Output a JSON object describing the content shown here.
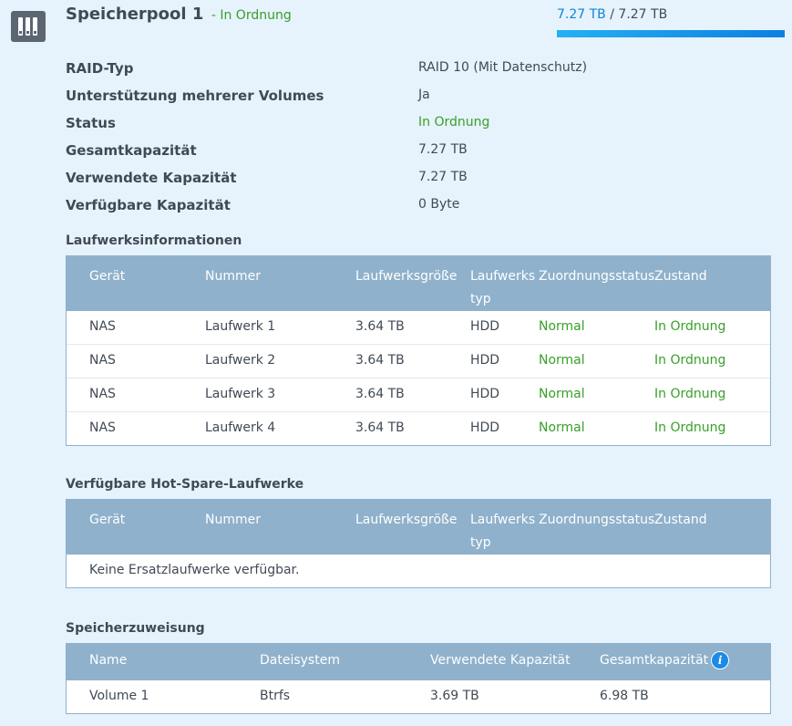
{
  "header": {
    "pool_name": "Speicherpool 1",
    "separator": "-",
    "pool_status": "In Ordnung",
    "used_capacity": "7.27 TB",
    "capacity_separator": "/",
    "total_capacity": "7.27 TB",
    "usage_fraction": 1.0,
    "usage_bar_color": "#0d86d6"
  },
  "info": [
    {
      "label": "RAID-Typ",
      "value": "RAID 10 (Mit Datenschutz)"
    },
    {
      "label": "Unterstützung mehrerer Volumes",
      "value": "Ja"
    },
    {
      "label": "Status",
      "value": "In Ordnung"
    },
    {
      "label": "Gesamtkapazität",
      "value": "7.27 TB"
    },
    {
      "label": "Verwendete Kapazität",
      "value": "7.27 TB"
    },
    {
      "label": "Verfügbare Kapazität",
      "value": "0 Byte"
    }
  ],
  "drives": {
    "title": "Laufwerksinformationen",
    "headers": [
      "Gerät",
      "Nummer",
      "Laufwerksgröße",
      "Laufwerks typ",
      "Zuordnungsstatus",
      "Zustand"
    ],
    "rows": [
      [
        "NAS",
        "Laufwerk 1",
        "3.64 TB",
        "HDD",
        "Normal",
        "In Ordnung"
      ],
      [
        "NAS",
        "Laufwerk 2",
        "3.64 TB",
        "HDD",
        "Normal",
        "In Ordnung"
      ],
      [
        "NAS",
        "Laufwerk 3",
        "3.64 TB",
        "HDD",
        "Normal",
        "In Ordnung"
      ],
      [
        "NAS",
        "Laufwerk 4",
        "3.64 TB",
        "HDD",
        "Normal",
        "In Ordnung"
      ]
    ]
  },
  "hot_spare": {
    "title": "Verfügbare Hot-Spare-Laufwerke",
    "headers": [
      "Gerät",
      "Nummer",
      "Laufwerksgröße",
      "Laufwerks typ",
      "Zuordnungsstatus",
      "Zustand"
    ],
    "empty_text": "Keine Ersatzlaufwerke verfügbar."
  },
  "allocation": {
    "title": "Speicherzuweisung",
    "headers": [
      "Name",
      "Dateisystem",
      "Verwendete Kapazität",
      "Gesamtkapazität"
    ],
    "info_icon": "info-icon",
    "rows": [
      [
        "Volume 1",
        "Btrfs",
        "3.69 TB",
        "6.98 TB"
      ]
    ]
  },
  "colors": {
    "ok": "#38a02a",
    "header_bg": "#8fb1cb",
    "page_bg": "#e6f3fc"
  }
}
